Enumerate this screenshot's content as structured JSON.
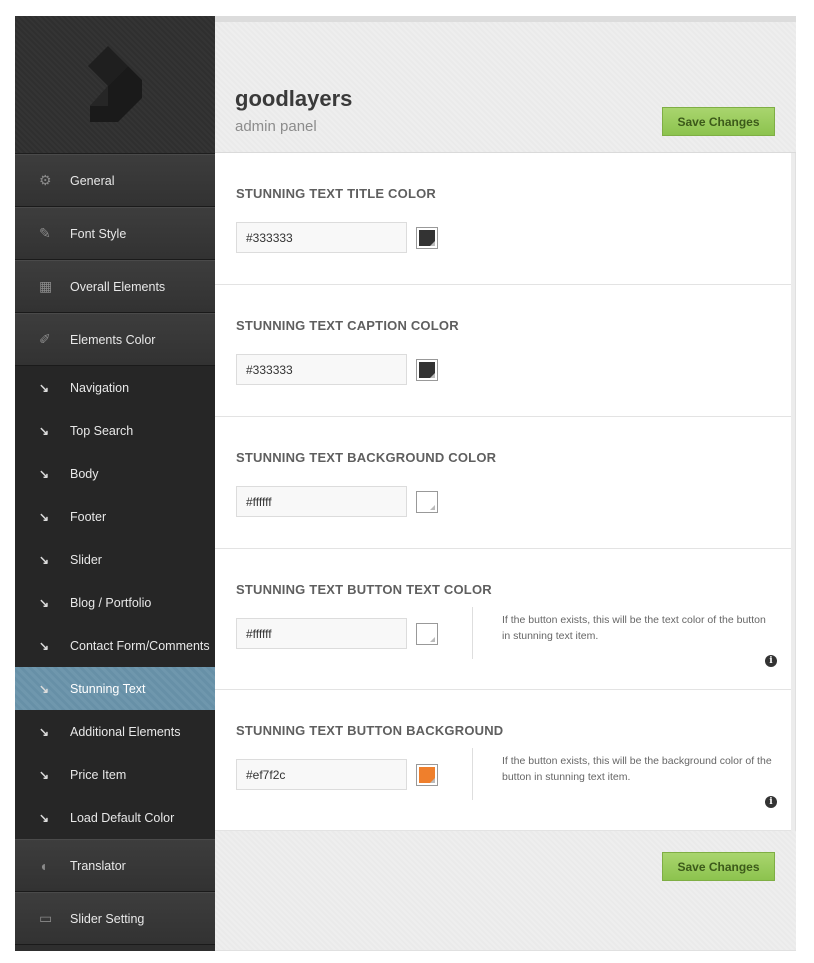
{
  "sidebar": {
    "main_items_top": [
      {
        "label": "General",
        "icon": "gear-icon",
        "glyph": "⚙"
      },
      {
        "label": "Font Style",
        "icon": "pencil-icon",
        "glyph": "✎"
      },
      {
        "label": "Overall Elements",
        "icon": "layout-icon",
        "glyph": "▦"
      },
      {
        "label": "Elements Color",
        "icon": "brush-icon",
        "glyph": "✐"
      }
    ],
    "sub_items": [
      {
        "label": "Navigation",
        "active": false
      },
      {
        "label": "Top Search",
        "active": false
      },
      {
        "label": "Body",
        "active": false
      },
      {
        "label": "Footer",
        "active": false
      },
      {
        "label": "Slider",
        "active": false
      },
      {
        "label": "Blog / Portfolio",
        "active": false
      },
      {
        "label": "Contact Form/Comments",
        "active": false
      },
      {
        "label": "Stunning Text",
        "active": true
      },
      {
        "label": "Additional Elements",
        "active": false
      },
      {
        "label": "Price Item",
        "active": false
      },
      {
        "label": "Load Default Color",
        "active": false
      }
    ],
    "sub_arrow": "↘",
    "main_items_bottom": [
      {
        "label": "Translator",
        "icon": "pacman-icon",
        "glyph": "◖"
      },
      {
        "label": "Slider Setting",
        "icon": "slides-icon",
        "glyph": "▭"
      }
    ]
  },
  "header": {
    "title": "goodlayers",
    "subtitle": "admin panel",
    "save_label": "Save Changes"
  },
  "sections": [
    {
      "title": "STUNNING TEXT TITLE COLOR",
      "value": "#333333",
      "swatch": "#333333",
      "description": ""
    },
    {
      "title": "STUNNING TEXT CAPTION COLOR",
      "value": "#333333",
      "swatch": "#333333",
      "description": ""
    },
    {
      "title": "STUNNING TEXT BACKGROUND COLOR",
      "value": "#ffffff",
      "swatch": "#ffffff",
      "description": ""
    },
    {
      "title": "STUNNING TEXT BUTTON TEXT COLOR",
      "value": "#ffffff",
      "swatch": "#ffffff",
      "description": "If the button exists, this will be the text color of the button in stunning text item."
    },
    {
      "title": "STUNNING TEXT BUTTON BACKGROUND",
      "value": "#ef7f2c",
      "swatch": "#ef7f2c",
      "description": "If the button exists, this will be the background color of the button in stunning text item."
    }
  ],
  "footer": {
    "save_label": "Save Changes"
  },
  "info_glyph": "i"
}
